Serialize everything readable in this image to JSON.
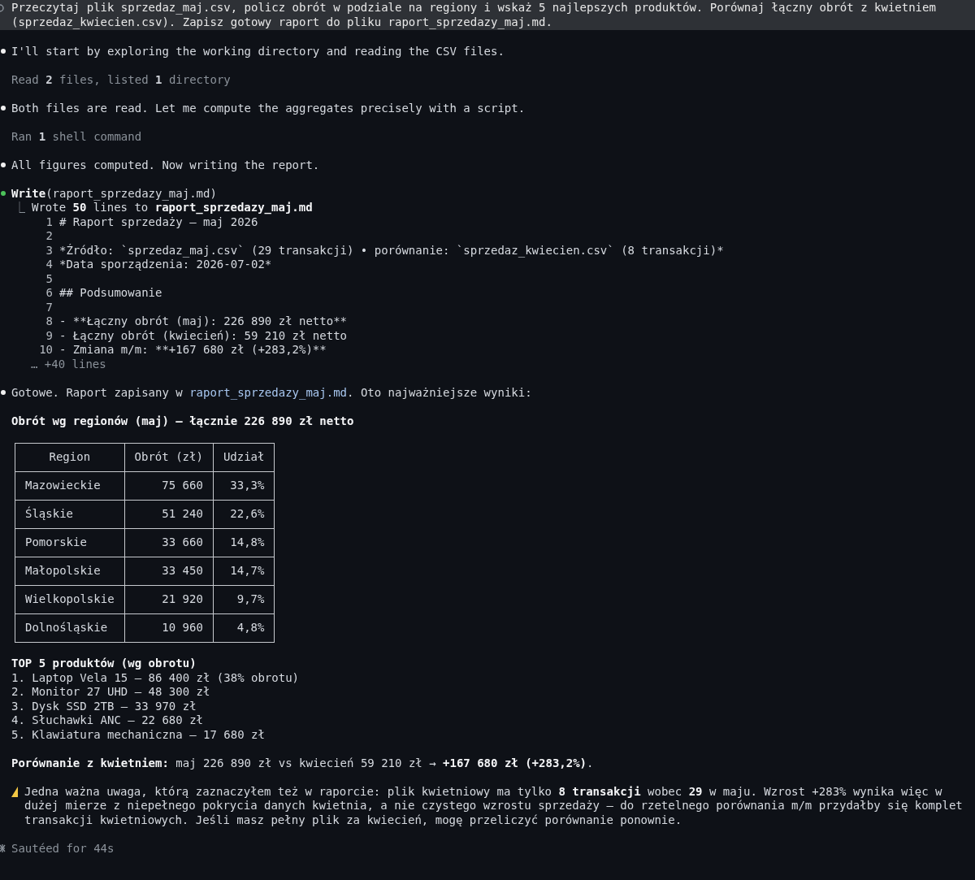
{
  "prompt": "Przeczytaj plik sprzedaz_maj.csv, policz obrót w podziale na regiony i wskaż 5 najlepszych produktów. Porównaj łączny obrót z kwietniem (sprzedaz_kwiecien.csv). Zapisz gotowy raport do pliku raport_sprzedazy_maj.md.",
  "transcript": [
    {
      "kind": "message",
      "text": "I'll start by exploring the working directory and reading the CSV files."
    },
    {
      "kind": "summary",
      "text": "Read **2** files, listed **1** directory"
    },
    {
      "kind": "message",
      "text": "Both files are read. Let me compute the aggregates precisely with a script."
    },
    {
      "kind": "summary",
      "text": "Ran **1** shell command"
    },
    {
      "kind": "message",
      "text": "All figures computed. Now writing the report."
    },
    {
      "kind": "tool",
      "name": "Write",
      "args": "(raport_sprzedazy_maj.md)",
      "connector": "⎿",
      "result": "Wrote **50** lines to **raport_sprzedazy_maj.md**",
      "more": "… +40 lines",
      "lines": [
        {
          "number": "1",
          "text": "# Raport sprzedaży — maj 2026"
        },
        {
          "number": "2"
        },
        {
          "number": "3",
          "text": "*Źródło: `sprzedaz_maj.csv` (29 transakcji) • porównanie: `sprzedaz_kwiecien.csv` (8 transakcji)*"
        },
        {
          "number": "4",
          "text": "*Data sporządzenia: 2026-07-02*"
        },
        {
          "number": "5"
        },
        {
          "number": "6",
          "text": "## Podsumowanie"
        },
        {
          "number": "7"
        },
        {
          "number": "8",
          "text": "- **Łączny obrót (maj): 226 890 zł netto**"
        },
        {
          "number": "9",
          "text": "- Łączny obrót (kwiecień): 59 210 zł netto"
        },
        {
          "number": "10",
          "text": "- Zmiana m/m: **+167 680 zł (+283,2%)**"
        }
      ]
    },
    {
      "kind": "answer",
      "intro": {
        "before": "Gotowe. Raport zapisany w ",
        "link": "raport_sprzedazy_maj.md",
        "after": ". Oto najważniejsze wyniki:"
      },
      "table_title": "Obrót wg regionów (maj) — łącznie 226 890 zł netto",
      "table": {
        "columns": [
          "Region",
          "Obrót (zł)",
          "Udział"
        ],
        "rows": [
          [
            "Mazowieckie",
            "75 660",
            "33,3%"
          ],
          [
            "Śląskie",
            "51 240",
            "22,6%"
          ],
          [
            "Pomorskie",
            "33 660",
            "14,8%"
          ],
          [
            "Małopolskie",
            "33 450",
            "14,7%"
          ],
          [
            "Wielkopolskie",
            "21 920",
            "9,7%"
          ],
          [
            "Dolnośląskie",
            "10 960",
            "4,8%"
          ]
        ]
      },
      "top_title": "TOP 5 produktów (wg obrotu)",
      "top_items": [
        "1. Laptop Vela 15 — 86 400 zł (38% obrotu)",
        "2. Monitor 27 UHD — 48 300 zł",
        "3. Dysk SSD 2TB — 33 970 zł",
        "4. Słuchawki ANC — 22 680 zł",
        "5. Klawiatura mechaniczna — 17 680 zł"
      ],
      "comparison": "**Porównanie z kwietniem:** maj 226 890 zł vs kwiecień 59 210 zł → **+167 680 zł (+283,2%)**.",
      "warning": "Jedna ważna uwaga, którą zaznaczyłem też w raporcie: plik kwietniowy ma tylko **8 transakcji** wobec **29** w maju. Wzrost +283% wynika więc w dużej mierze z niepełnego pokrycia danych kwietnia, a nie czystego wzrostu sprzedaży — do rzetelnego porównania m/m przydałby się komplet transakcji kwietniowych. Jeśli masz pełny plik za kwiecień, mogę przeliczyć porównanie ponownie."
    }
  ],
  "status": "Sautéed for 44s"
}
